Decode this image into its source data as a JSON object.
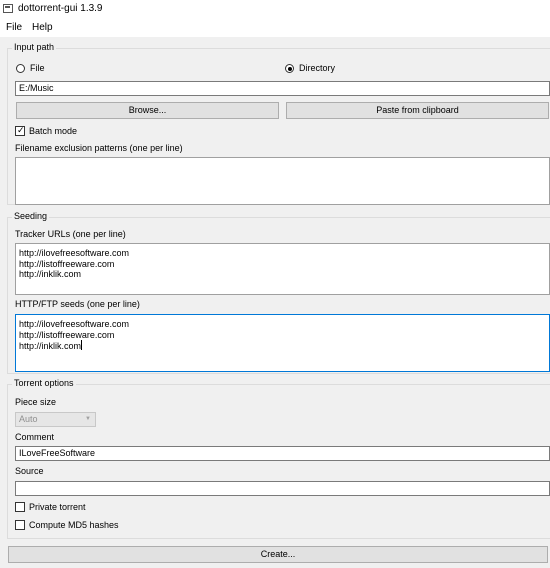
{
  "window": {
    "title": "dottorrent-gui 1.3.9"
  },
  "menu": {
    "file": "File",
    "help": "Help"
  },
  "input_path": {
    "group_title": "Input path",
    "radio_file": "File",
    "radio_directory": "Directory",
    "path_value": "E:/Music",
    "browse_label": "Browse...",
    "paste_label": "Paste from clipboard",
    "batch_mode_label": "Batch mode",
    "exclusion_label": "Filename exclusion patterns (one per line)",
    "exclusion_value": ""
  },
  "seeding": {
    "group_title": "Seeding",
    "tracker_label": "Tracker URLs (one per line)",
    "trackers": [
      "http://ilovefreesoftware.com",
      "http://listoffreeware.com",
      "http://inklik.com"
    ],
    "seeds_label": "HTTP/FTP seeds (one per line)",
    "seeds": [
      "http://ilovefreesoftware.com",
      "http://listoffreeware.com",
      "http://inklik.com"
    ]
  },
  "torrent_options": {
    "group_title": "Torrent options",
    "piece_size_label": "Piece size",
    "piece_size_value": "Auto",
    "comment_label": "Comment",
    "comment_value": "ILoveFreeSoftware",
    "source_label": "Source",
    "source_value": "",
    "private_label": "Private torrent",
    "md5_label": "Compute MD5 hashes"
  },
  "create_label": "Create..."
}
